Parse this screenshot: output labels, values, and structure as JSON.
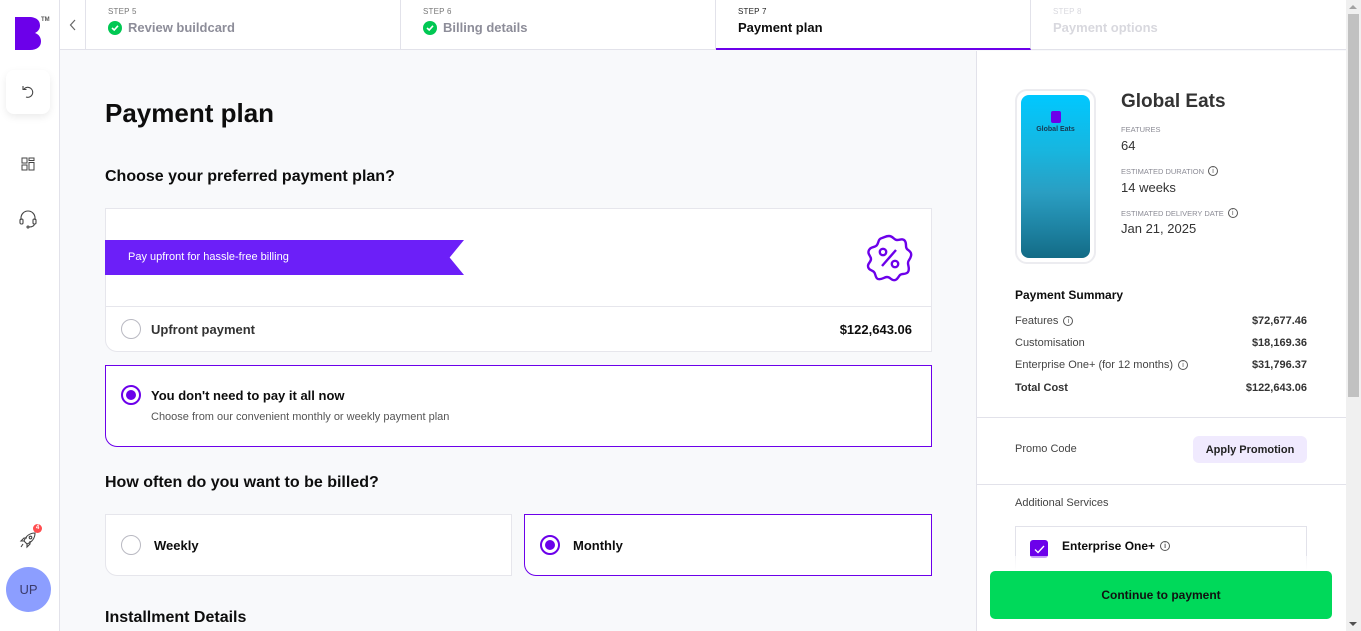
{
  "brand": {
    "logo_letter": "B",
    "trademark": "TM",
    "accent": "#6c00ea",
    "success": "#00c853",
    "cta_color": "#00d95a"
  },
  "rail": {
    "undo_icon": "undo-icon",
    "grid_icon": "grid-icon",
    "support_icon": "headset-icon",
    "rocket_icon": "rocket-icon",
    "rocket_badge": "4",
    "avatar_initials": "UP"
  },
  "steps": [
    {
      "num": "STEP 5",
      "title": "Review buildcard",
      "state": "completed"
    },
    {
      "num": "STEP 6",
      "title": "Billing details",
      "state": "completed"
    },
    {
      "num": "STEP 7",
      "title": "Payment plan",
      "state": "active"
    },
    {
      "num": "STEP 8",
      "title": "Payment options",
      "state": "disabled"
    }
  ],
  "main": {
    "title": "Payment plan",
    "plan_question": "Choose your preferred payment plan?",
    "upfront": {
      "ribbon": "Pay upfront for hassle-free billing",
      "label": "Upfront payment",
      "price": "$122,643.06",
      "selected": false
    },
    "installment": {
      "label": "You don't need to pay it all now",
      "sub": "Choose from our convenient monthly or weekly payment plan",
      "selected": true
    },
    "billing_question": "How often do you want to be billed?",
    "frequency": [
      {
        "label": "Weekly",
        "selected": false
      },
      {
        "label": "Monthly",
        "selected": true
      }
    ],
    "installment_details_title": "Installment Details"
  },
  "side": {
    "project_name": "Global Eats",
    "phone_app_name": "Global Eats",
    "features_label": "FEATURES",
    "features_value": "64",
    "duration_label": "ESTIMATED DURATION",
    "duration_value": "14 weeks",
    "delivery_label": "ESTIMATED DELIVERY DATE",
    "delivery_value": "Jan 21, 2025",
    "summary_title": "Payment Summary",
    "summary": [
      {
        "label": "Features",
        "value": "$72,677.46",
        "info": true
      },
      {
        "label": "Customisation",
        "value": "$18,169.36",
        "info": false
      },
      {
        "label": "Enterprise One+ (for 12 months)",
        "value": "$31,796.37",
        "info": true
      },
      {
        "label": "Total Cost",
        "value": "$122,643.06",
        "info": false
      }
    ],
    "promo_label": "Promo Code",
    "promo_button": "Apply Promotion",
    "additional_label": "Additional Services",
    "service_name": "Enterprise One+",
    "service_checked": true,
    "cta": "Continue to payment"
  }
}
